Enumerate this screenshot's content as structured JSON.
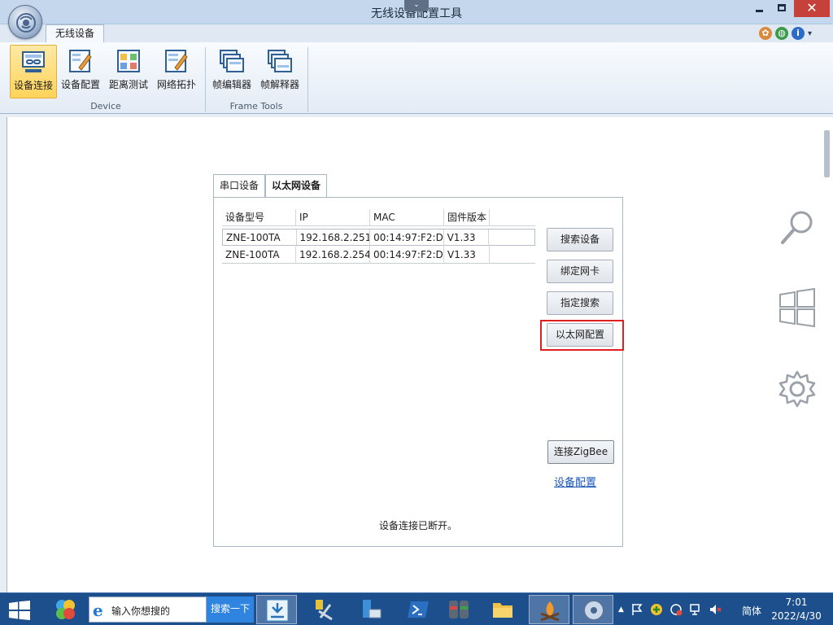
{
  "window": {
    "title": "无线设备配置工具",
    "chevron": "⌄",
    "minimize": "–",
    "maximize": "□",
    "close": "✕"
  },
  "ribbon": {
    "tab": "无线设备",
    "groups": [
      {
        "label": "Device",
        "buttons": [
          "设备连接",
          "设备配置",
          "距离测试",
          "网络拓扑"
        ]
      },
      {
        "label": "Frame Tools",
        "buttons": [
          "帧编辑器",
          "帧解释器"
        ]
      }
    ],
    "help_icons": [
      "palette-icon",
      "globe-icon",
      "info-icon",
      "dropdown-icon"
    ]
  },
  "dialog": {
    "tabs": [
      "串口设备",
      "以太网设备"
    ],
    "active_tab": "以太网设备",
    "table": {
      "columns": [
        "设备型号",
        "IP",
        "MAC",
        "固件版本",
        ""
      ],
      "rows": [
        [
          "ZNE-100TA",
          "192.168.2.251",
          "00:14:97:F2:D...",
          "V1.33",
          ""
        ],
        [
          "ZNE-100TA",
          "192.168.2.254",
          "00:14:97:F2:D...",
          "V1.33",
          ""
        ]
      ]
    },
    "buttons": {
      "search": "搜索设备",
      "bind_nic": "绑定网卡",
      "targeted_search": "指定搜索",
      "ethernet_config": "以太网配置",
      "connect_zigbee": "连接ZigBee"
    },
    "link_config": "设备配置",
    "status": "设备连接已断开。",
    "highlight_color": "#e01f1f"
  },
  "charms": [
    "search-icon",
    "windows-start-icon",
    "settings-gear-icon"
  ],
  "taskbar": {
    "search_placeholder": "输入你想搜的",
    "search_button": "搜索一下",
    "apps": [
      "360-safe-icon",
      "network-share-icon",
      "tools-icon",
      "server-manager-icon",
      "powershell-icon",
      "database-icon",
      "file-explorer-icon",
      "campfire-app-icon",
      "wireless-config-tool-icon"
    ],
    "ime": "简体",
    "time": "7:01",
    "date": "2022/4/30"
  }
}
